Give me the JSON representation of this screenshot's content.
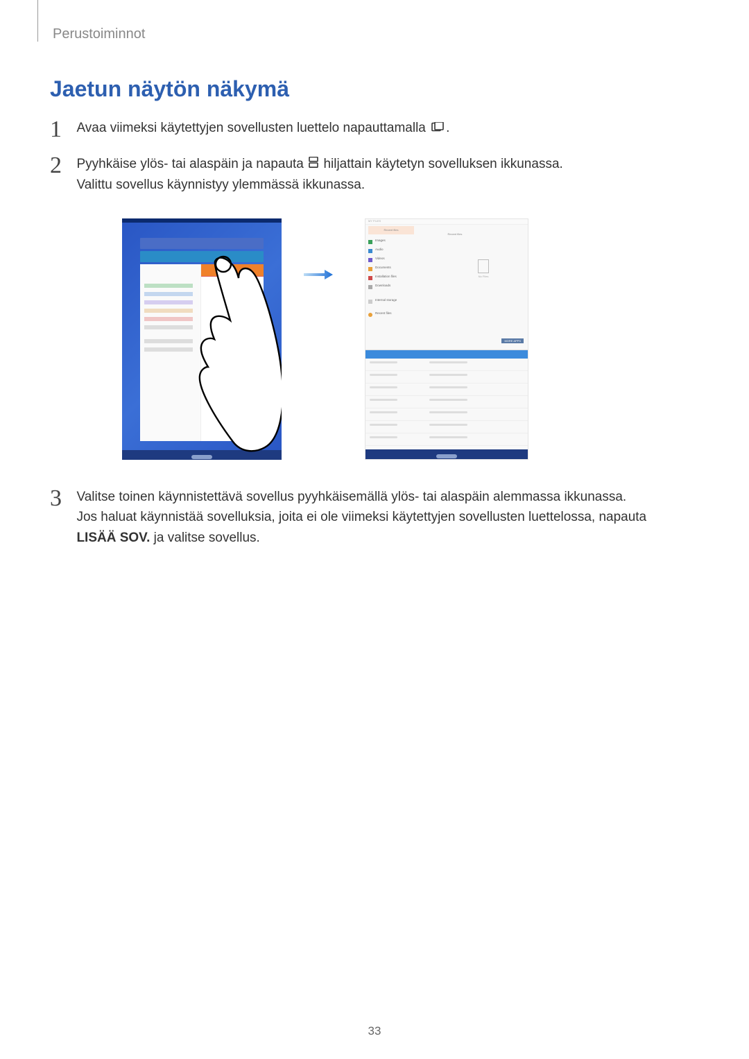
{
  "header": "Perustoiminnot",
  "section_title": "Jaetun näytön näkymä",
  "steps": {
    "s1": {
      "num": "1",
      "text_a": "Avaa viimeksi käytettyjen sovellusten luettelo napauttamalla ",
      "text_b": "."
    },
    "s2": {
      "num": "2",
      "line1_a": "Pyyhkäise ylös- tai alaspäin ja napauta ",
      "line1_b": " hiljattain käytetyn sovelluksen ikkunassa.",
      "line2": "Valittu sovellus käynnistyy ylemmässä ikkunassa."
    },
    "s3": {
      "num": "3",
      "line1": "Valitse toinen käynnistettävä sovellus pyyhkäisemällä ylös- tai alaspäin alemmassa ikkunassa.",
      "line2_a": "Jos haluat käynnistää sovelluksia, joita ei ole viimeksi käytettyjen sovellusten luettelossa, napauta ",
      "line2_bold": "LISÄÄ SOV.",
      "line2_b": " ja valitse sovellus."
    }
  },
  "figure": {
    "right": {
      "title_bar": "MY FILES",
      "tab": "Recent files",
      "header_right": "Recent files",
      "items": [
        {
          "icon": "#3aa05a",
          "label": "Images"
        },
        {
          "icon": "#3a8ad0",
          "label": "Audio"
        },
        {
          "icon": "#6f5acc",
          "label": "Videos"
        },
        {
          "icon": "#e8a03a",
          "label": "Documents"
        },
        {
          "icon": "#cf4a4a",
          "label": "Installation files"
        },
        {
          "icon": "#aaaaaa",
          "label": "Downloads"
        }
      ],
      "storage_header": "",
      "storage1": "Internal storage",
      "storage2": "Recent files",
      "no_files": "No Files",
      "more_apps": "MORE APPS"
    }
  },
  "page_number": "33"
}
